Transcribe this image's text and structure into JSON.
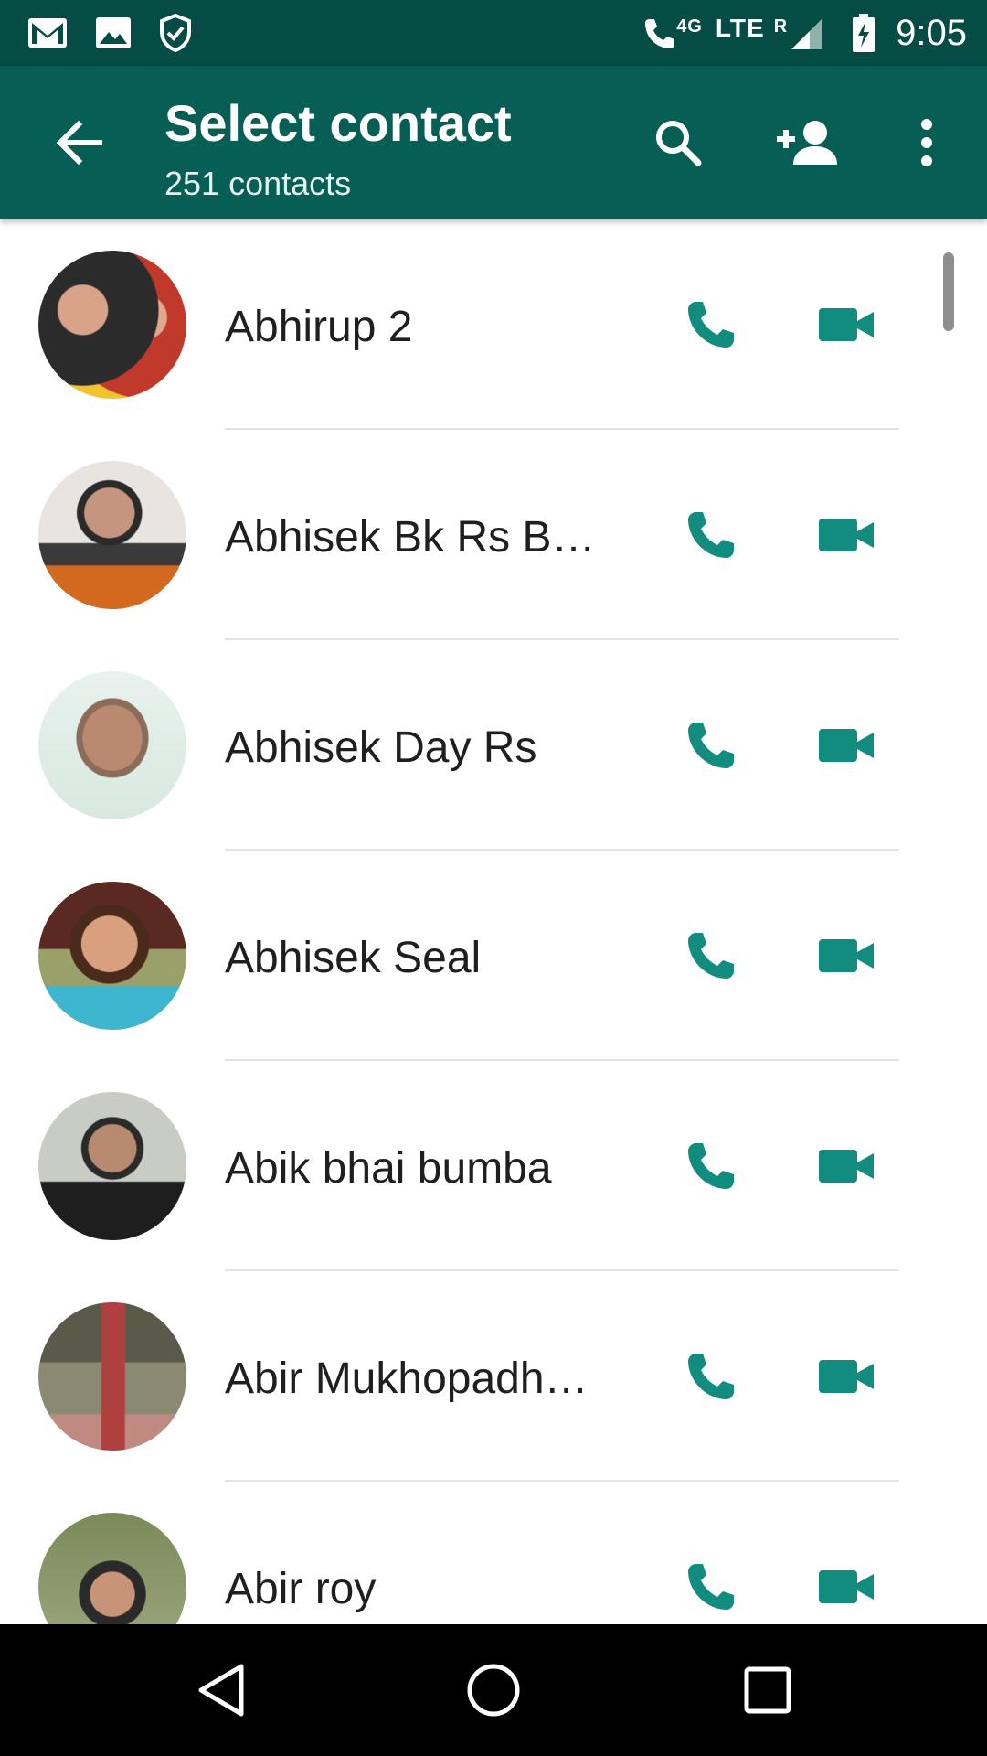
{
  "status_bar": {
    "left_icons": [
      "gmail-icon",
      "image-icon",
      "shield-check-icon"
    ],
    "network_label": "4G",
    "lte_label": "LTE",
    "roaming_label": "R",
    "time": "9:05"
  },
  "app_bar": {
    "title": "Select contact",
    "subtitle": "251 contacts",
    "actions": [
      "search-icon",
      "add-contact-icon",
      "more-vert-icon"
    ]
  },
  "contacts": [
    {
      "name": "Abhirup 2",
      "avatar_colors": [
        "#2b2b2b",
        "#c0392b"
      ]
    },
    {
      "name": "Abhisek Bk Rs B…",
      "avatar_colors": [
        "#3a3a3a",
        "#d2691e"
      ]
    },
    {
      "name": "Abhisek Day Rs",
      "avatar_colors": [
        "#d8e8e0",
        "#8b6b5a"
      ]
    },
    {
      "name": "Abhisek Seal",
      "avatar_colors": [
        "#4a2a1a",
        "#3fb6d0"
      ]
    },
    {
      "name": "Abik bhai bumba",
      "avatar_colors": [
        "#9aa39a",
        "#1e1e1e"
      ]
    },
    {
      "name": "Abir Mukhopadh…",
      "avatar_colors": [
        "#6b6b5a",
        "#b04040"
      ]
    },
    {
      "name": "Abir roy",
      "avatar_colors": [
        "#7a8a5a",
        "#2a2a2a"
      ]
    }
  ],
  "colors": {
    "status_bar": "#054d44",
    "app_bar": "#075e54",
    "accent": "#128c7e",
    "nav_bar": "#000000"
  },
  "nav_bar": [
    "back-triangle-icon",
    "home-circle-icon",
    "recents-square-icon"
  ]
}
